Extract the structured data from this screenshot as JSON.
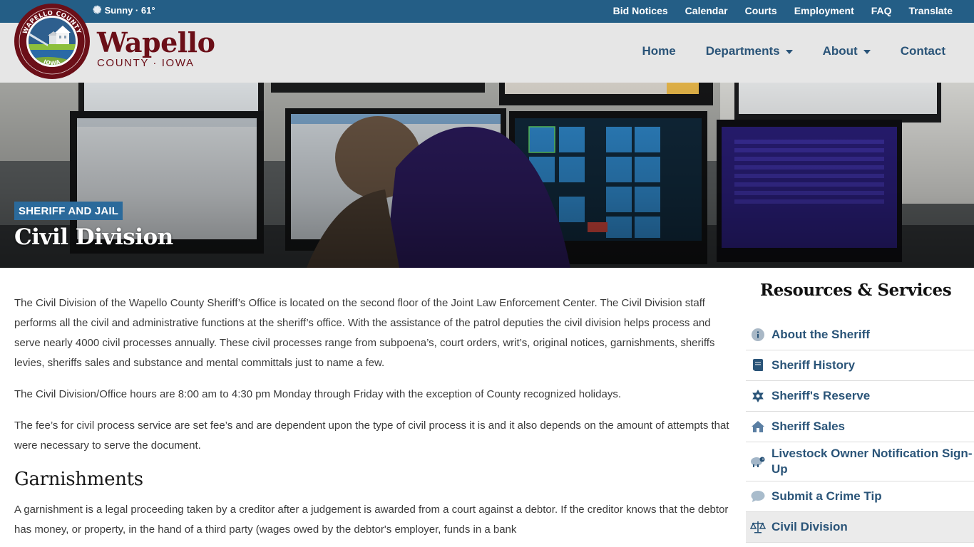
{
  "weather": {
    "icon": "sun-icon",
    "text": "Sunny · 61°"
  },
  "utility_nav": [
    "Bid Notices",
    "Calendar",
    "Courts",
    "Employment",
    "FAQ",
    "Translate"
  ],
  "brand": {
    "name": "Wapello",
    "subtitle": "COUNTY · IOWA",
    "seal_top_text": "WAPELLO COUNTY",
    "seal_bottom_text": "IOWA"
  },
  "main_nav": [
    {
      "label": "Home",
      "has_dropdown": false
    },
    {
      "label": "Departments",
      "has_dropdown": true
    },
    {
      "label": "About",
      "has_dropdown": true
    },
    {
      "label": "Contact",
      "has_dropdown": false
    }
  ],
  "hero": {
    "tag": "SHERIFF AND JAIL",
    "title": "Civil Division"
  },
  "content": {
    "paragraphs": [
      "The Civil Division of the Wapello County Sheriff’s Office is located on the second floor of the Joint Law Enforcement Center.  The Civil Division staff performs all the civil and administrative functions at the sheriff’s office.  With the assistance of the patrol deputies the civil division helps process and serve nearly 4000 civil processes annually.  These civil processes range from subpoena’s, court orders, writ’s, original notices, garnishments, sheriffs levies, sheriffs sales and substance and mental committals just to name a few.",
      "The Civil Division/Office hours are 8:00 am to 4:30 pm Monday through Friday with the exception of County recognized holidays.",
      "The fee’s for civil process service are set fee’s and are dependent upon the type of civil process it is and it also depends on the amount of attempts that were necessary to serve the document."
    ],
    "section_heading": "Garnishments",
    "section_paragraph": "A garnishment is a legal proceeding taken by a creditor after a judgement is awarded from a court against a debtor. If the creditor knows that the debtor has money, or property, in the hand of a third party (wages owed by the debtor's employer, funds in a bank"
  },
  "sidebar": {
    "title": "Resources & Services",
    "items": [
      {
        "label": "About the Sheriff",
        "icon": "info-circle-icon",
        "active": false
      },
      {
        "label": "Sheriff History",
        "icon": "book-icon",
        "active": false
      },
      {
        "label": "Sheriff's Reserve",
        "icon": "star-badge-icon",
        "active": false
      },
      {
        "label": "Sheriff Sales",
        "icon": "home-icon",
        "active": false
      },
      {
        "label": "Livestock Owner Notification Sign-Up",
        "icon": "sheep-icon",
        "active": false
      },
      {
        "label": "Submit a Crime Tip",
        "icon": "comment-icon",
        "active": false
      },
      {
        "label": "Civil Division",
        "icon": "scale-icon",
        "active": true
      }
    ]
  },
  "colors": {
    "topbar": "#245e86",
    "header_bg": "#e6e6e6",
    "brand_maroon": "#6b0f18",
    "nav_blue": "#2a5478",
    "tag_blue": "#2b6a9b",
    "active_item_bg": "#ebebeb"
  }
}
